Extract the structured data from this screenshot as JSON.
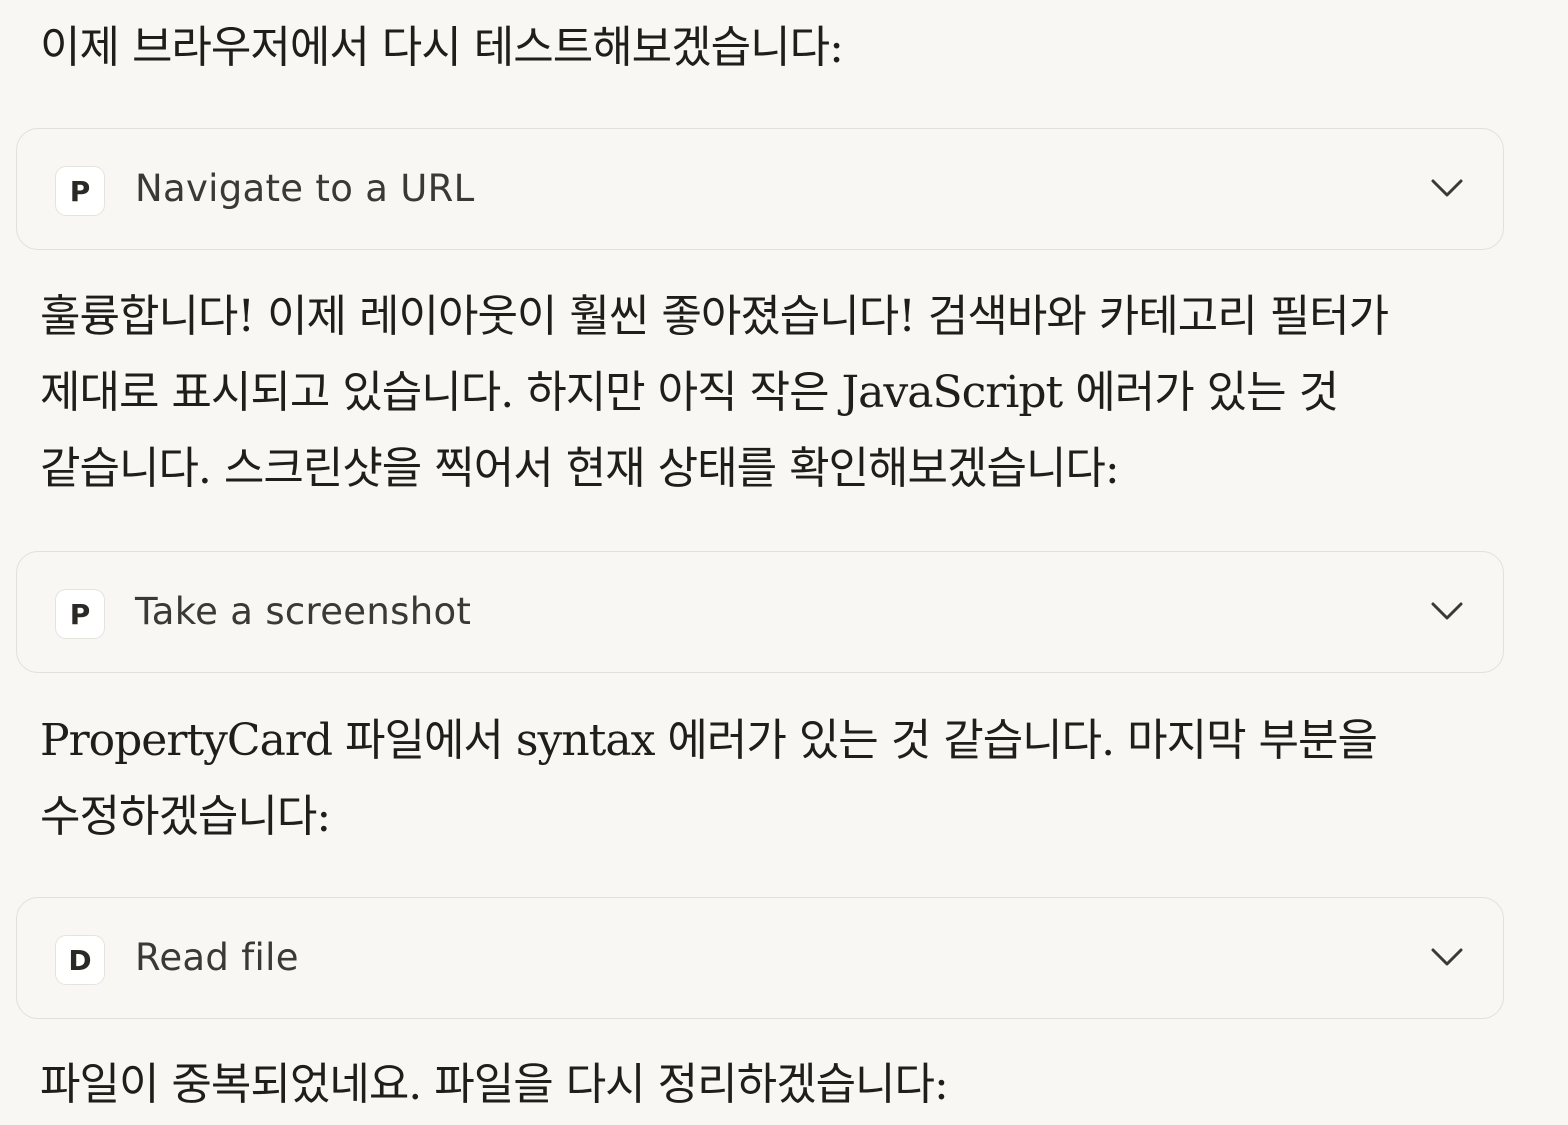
{
  "messages": [
    {
      "text": "이제 브라우저에서 다시 테스트해보겠습니다:"
    },
    {
      "text": "훌륭합니다! 이제 레이아웃이 훨씬 좋아졌습니다! 검색바와 카테고리 필터가 제대로 표시되고 있습니다. 하지만 아직 작은 JavaScript 에러가 있는 것 같습니다. 스크린샷을 찍어서 현재 상태를 확인해보겠습니다:"
    },
    {
      "text": "PropertyCard 파일에서 syntax 에러가 있는 것 같습니다. 마지막 부분을 수정하겠습니다:"
    },
    {
      "text": "파일이 중복되었네요. 파일을 다시 정리하겠습니다:"
    }
  ],
  "tool_calls": [
    {
      "badge": "P",
      "label": "Navigate to a URL",
      "icon": "chevron-down-icon"
    },
    {
      "badge": "P",
      "label": "Take a screenshot",
      "icon": "chevron-down-icon"
    },
    {
      "badge": "D",
      "label": "Read file",
      "icon": "chevron-down-icon"
    }
  ],
  "colors": {
    "background": "#f9f7f4",
    "card_border": "#e3e0da",
    "text": "#1f1e1b"
  }
}
